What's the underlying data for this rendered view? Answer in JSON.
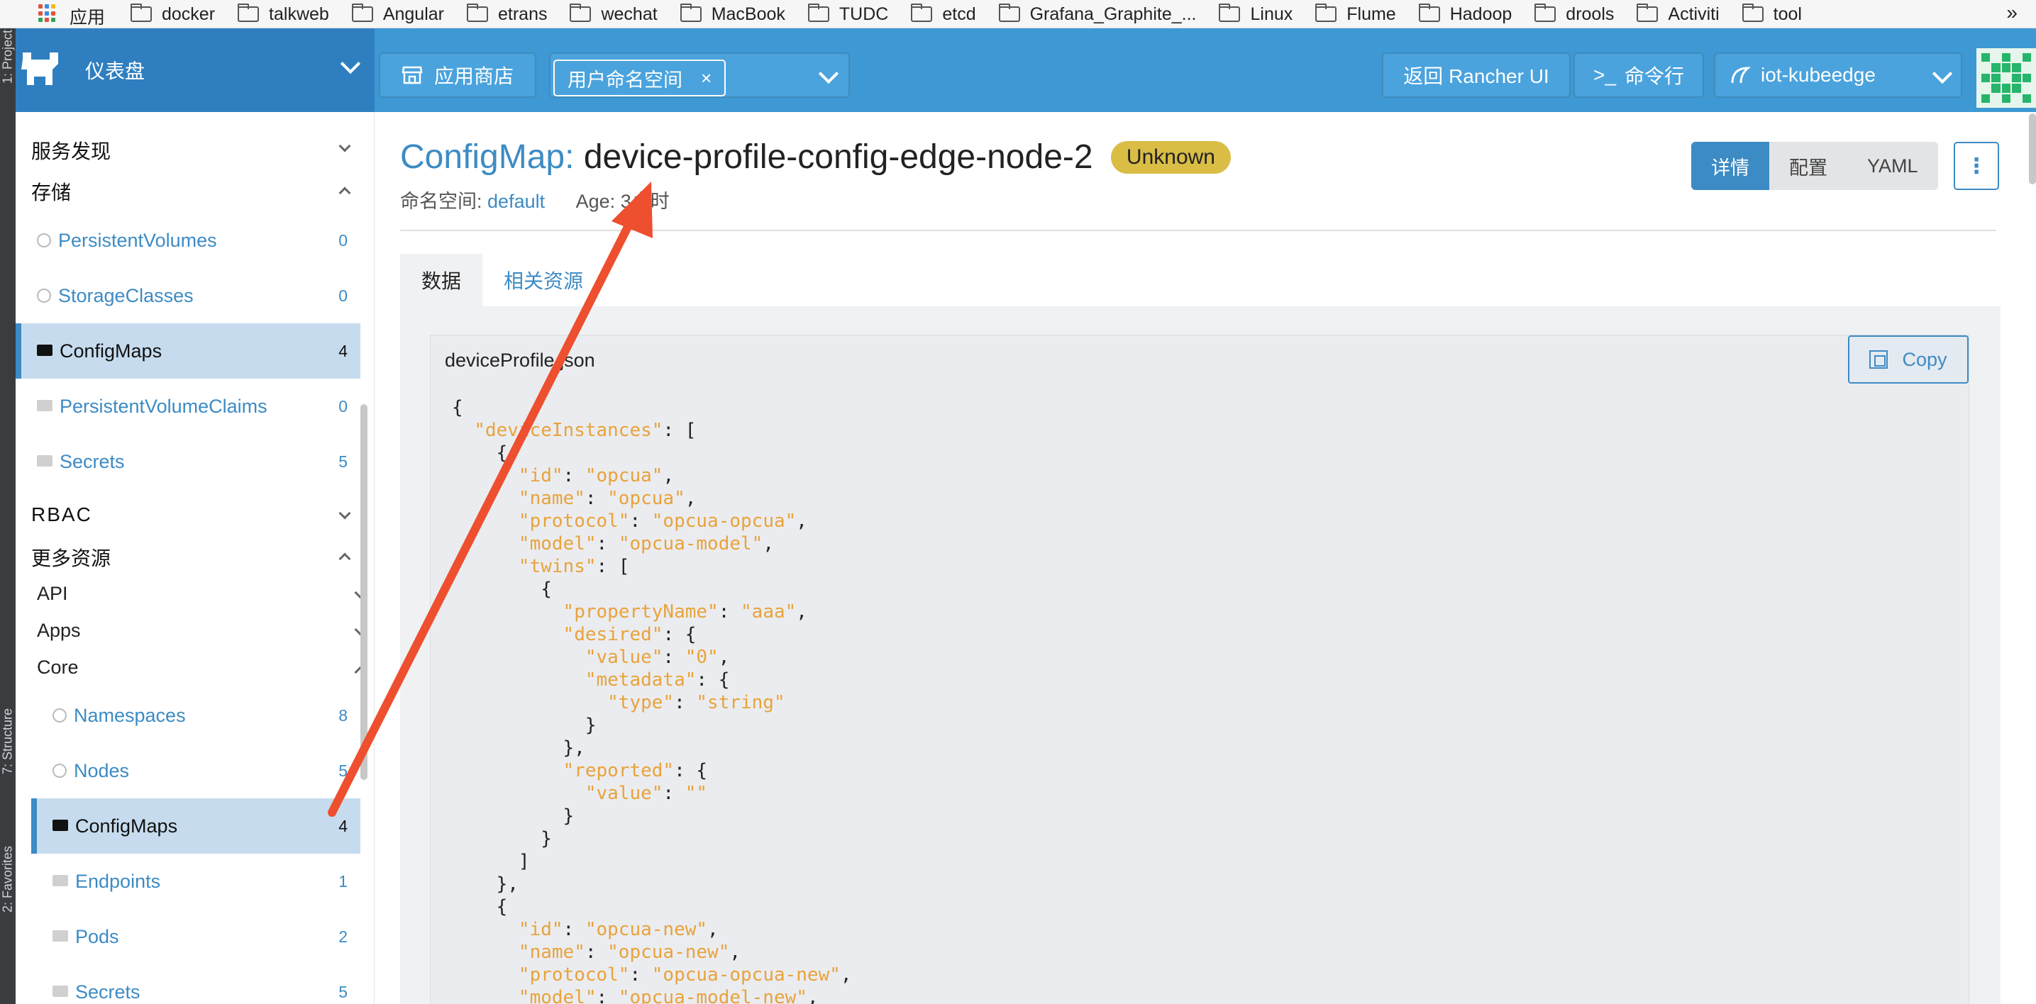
{
  "bookmarks": {
    "apps_label": "应用",
    "items": [
      "docker",
      "talkweb",
      "Angular",
      "etrans",
      "wechat",
      "MacBook",
      "TUDC",
      "etcd",
      "Grafana_Graphite_...",
      "Linux",
      "Flume",
      "Hadoop",
      "drools",
      "Activiti",
      "tool"
    ],
    "more": "»"
  },
  "ide": {
    "project": "1: Project",
    "structure": "7: Structure",
    "favorites": "2: Favorites"
  },
  "header": {
    "dashboard": "仪表盘",
    "app_store": "应用商店",
    "namespace_chip": "用户命名空间",
    "back_rancher": "返回 Rancher UI",
    "cli": "命令行",
    "cluster": "iot-kubeedge"
  },
  "sidebar": {
    "service_discovery": "服务发现",
    "storage": "存储",
    "storage_items": [
      {
        "label": "PersistentVolumes",
        "count": "0"
      },
      {
        "label": "StorageClasses",
        "count": "0"
      },
      {
        "label": "ConfigMaps",
        "count": "4"
      },
      {
        "label": "PersistentVolumeClaims",
        "count": "0"
      },
      {
        "label": "Secrets",
        "count": "5"
      }
    ],
    "rbac": "RBAC",
    "more_resources": "更多资源",
    "api": "API",
    "apps": "Apps",
    "core": "Core",
    "core_items": [
      {
        "label": "Namespaces",
        "count": "8"
      },
      {
        "label": "Nodes",
        "count": "5"
      },
      {
        "label": "ConfigMaps",
        "count": "4"
      },
      {
        "label": "Endpoints",
        "count": "1"
      },
      {
        "label": "Pods",
        "count": "2"
      },
      {
        "label": "Secrets",
        "count": "5"
      }
    ]
  },
  "main": {
    "kind": "ConfigMap:",
    "name": "device-profile-config-edge-node-2",
    "status": "Unknown",
    "namespace_label": "命名空间:",
    "namespace_value": "default",
    "age_label": "Age:",
    "age_value": "3小时",
    "view_tabs": [
      "详情",
      "配置",
      "YAML"
    ],
    "kebab": "⋮",
    "tabs": [
      "数据",
      "相关资源"
    ],
    "data_key": "deviceProfile.json",
    "copy": "Copy"
  },
  "colors": {
    "header": "#3d98d3",
    "brand": "#2f7fc0",
    "accent": "#3d8bc4",
    "badge": "#d9bd45",
    "arrow": "#ee4f2e"
  }
}
